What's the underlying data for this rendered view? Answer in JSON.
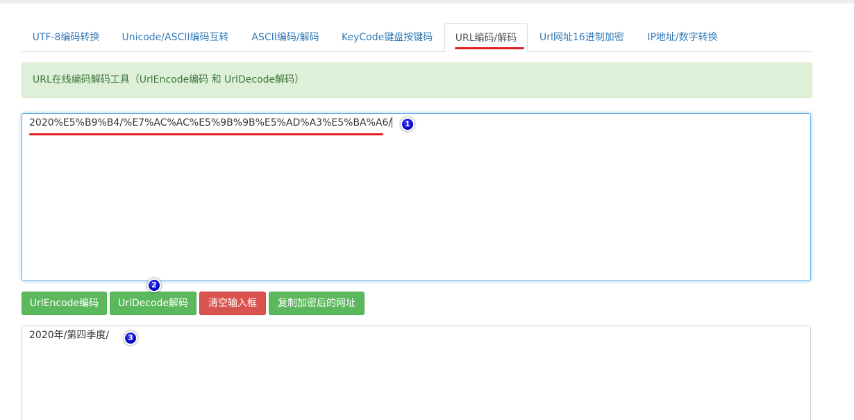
{
  "tabs": [
    {
      "label": "UTF-8编码转换",
      "active": false
    },
    {
      "label": "Unicode/ASCII编码互转",
      "active": false
    },
    {
      "label": "ASCII编码/解码",
      "active": false
    },
    {
      "label": "KeyCode键盘按键码",
      "active": false
    },
    {
      "label": "URL编码/解码",
      "active": true
    },
    {
      "label": "Url网址16进制加密",
      "active": false
    },
    {
      "label": "IP地址/数字转换",
      "active": false
    }
  ],
  "alert": {
    "text": "URL在线编码解码工具（UrlEncode编码 和 UrlDecode解码）"
  },
  "input": {
    "value": "2020%E5%B9%B4/%E7%AC%AC%E5%9B%9B%E5%AD%A3%E5%BA%A6/"
  },
  "buttons": {
    "encode": "UrlEncode编码",
    "decode": "UrlDecode解码",
    "clear": "清空输入框",
    "copy": "复制加密后的网址"
  },
  "output": {
    "value": "2020年/第四季度/"
  },
  "annotations": {
    "step1": "1",
    "step2": "2",
    "step3": "3"
  },
  "colors": {
    "success": "#5cb85c",
    "danger": "#d9534f",
    "link": "#337ab7",
    "highlight": "#e02020",
    "badge": "#0000cc"
  }
}
